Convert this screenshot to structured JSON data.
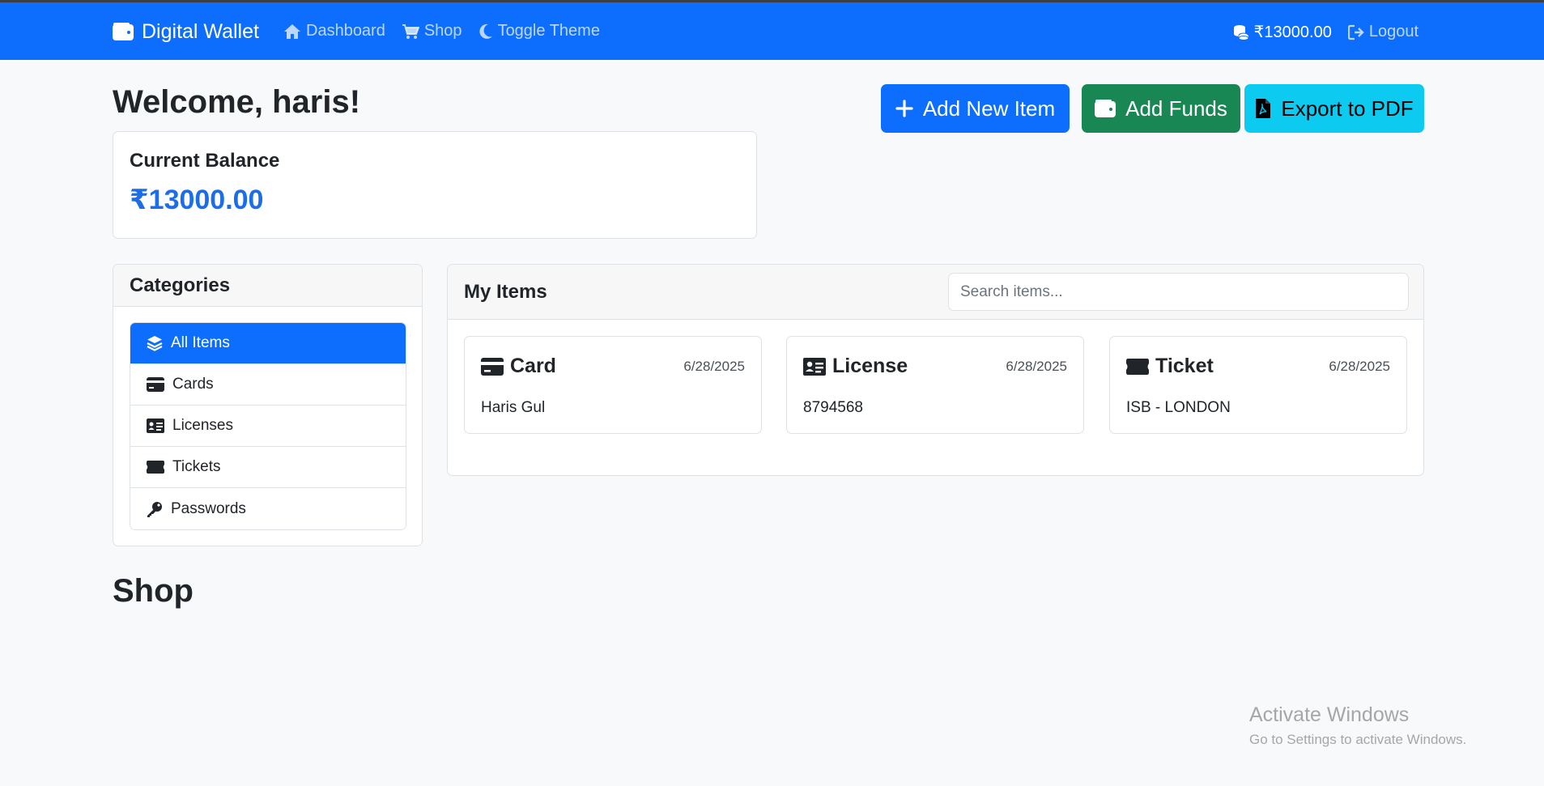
{
  "app": {
    "brand": "Digital Wallet",
    "nav": [
      {
        "label": "Dashboard",
        "icon": "home-icon"
      },
      {
        "label": "Shop",
        "icon": "cart-icon"
      },
      {
        "label": "Toggle Theme",
        "icon": "moon-icon"
      }
    ],
    "balance": "₹13000.00",
    "logout": "Logout"
  },
  "welcome": "Welcome, haris!",
  "balance_card": {
    "label": "Current Balance",
    "amount": "₹13000.00"
  },
  "actions": {
    "add_item": "Add New Item",
    "add_funds": "Add Funds",
    "export_pdf": "Export to PDF"
  },
  "categories": {
    "title": "Categories",
    "items": [
      {
        "label": "All Items",
        "icon": "layers-icon",
        "active": true
      },
      {
        "label": "Cards",
        "icon": "credit-card-icon",
        "active": false
      },
      {
        "label": "Licenses",
        "icon": "id-card-icon",
        "active": false
      },
      {
        "label": "Tickets",
        "icon": "ticket-icon",
        "active": false
      },
      {
        "label": "Passwords",
        "icon": "key-icon",
        "active": false
      }
    ]
  },
  "my_items": {
    "title": "My Items",
    "search_placeholder": "Search items...",
    "items": [
      {
        "type": "Card",
        "date": "6/28/2025",
        "value": "Haris Gul",
        "icon": "credit-card-icon"
      },
      {
        "type": "License",
        "date": "6/28/2025",
        "value": "8794568",
        "icon": "id-card-icon"
      },
      {
        "type": "Ticket",
        "date": "6/28/2025",
        "value": "ISB - LONDON",
        "icon": "ticket-icon"
      }
    ]
  },
  "shop": {
    "title": "Shop"
  },
  "watermark": {
    "line1": "Activate Windows",
    "line2": "Go to Settings to activate Windows."
  },
  "colors": {
    "primary": "#0d6efd",
    "success": "#198754",
    "info": "#0dcaf0",
    "balance_text": "#1c6ee8",
    "page_bg": "#f8f9fa"
  }
}
